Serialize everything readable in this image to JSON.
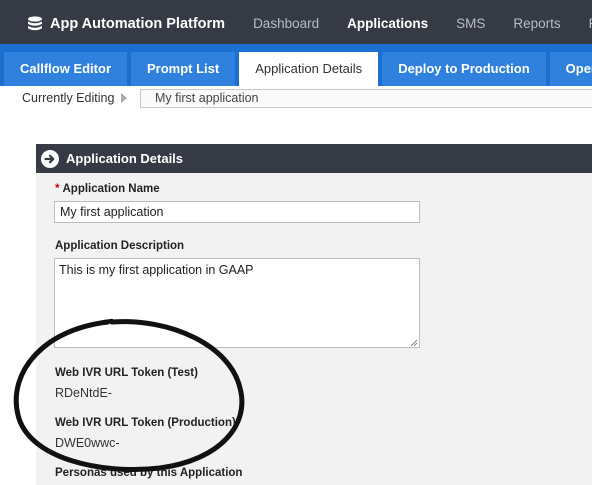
{
  "header": {
    "brand": "App Automation Platform",
    "nav": [
      "Dashboard",
      "Applications",
      "SMS",
      "Reports",
      "Personas"
    ],
    "active_nav": "Applications"
  },
  "tabs": [
    "Callflow Editor",
    "Prompt List",
    "Application Details",
    "Deploy to Production",
    "Opening Hours"
  ],
  "active_tab": "Application Details",
  "editing": {
    "label": "Currently Editing",
    "value": "My first application"
  },
  "panel": {
    "title": "Application Details",
    "required_mark": "*",
    "name_label": "Application Name",
    "name_value": "My first application",
    "description_label": "Application Description",
    "description_value": "This is my first application in GAAP",
    "token_test_label": "Web IVR URL Token (Test)",
    "token_test_value": "RDeNtdE-",
    "token_prod_label": "Web IVR URL Token (Production)",
    "token_prod_value": "DWE0wwc-",
    "personas_label": "Personas used by this Application"
  },
  "colors": {
    "topbar": "#353a44",
    "tabbar": "#1a6fd1",
    "tab": "#2f81dd",
    "required": "#d40000"
  }
}
